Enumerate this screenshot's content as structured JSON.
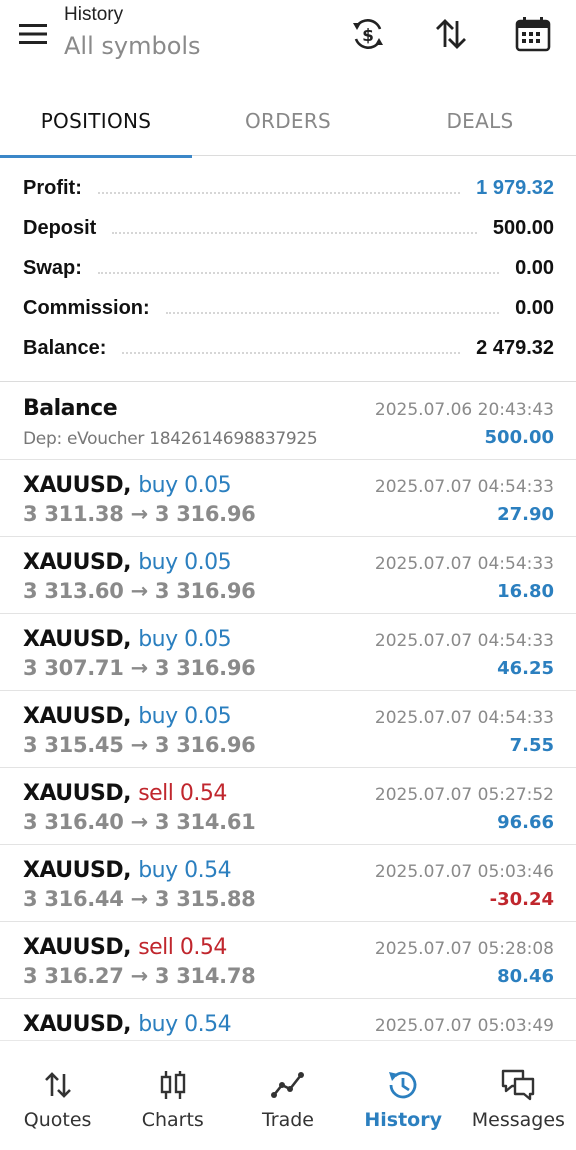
{
  "header": {
    "title": "History",
    "subtitle": "All symbols"
  },
  "tabs": [
    {
      "label": "POSITIONS",
      "active": true
    },
    {
      "label": "ORDERS",
      "active": false
    },
    {
      "label": "DEALS",
      "active": false
    }
  ],
  "summary": [
    {
      "label": "Profit:",
      "value": "1 979.32",
      "highlight": true
    },
    {
      "label": "Deposit",
      "value": "500.00",
      "highlight": false
    },
    {
      "label": "Swap:",
      "value": "0.00",
      "highlight": false
    },
    {
      "label": "Commission:",
      "value": "0.00",
      "highlight": false
    },
    {
      "label": "Balance:",
      "value": "2 479.32",
      "highlight": false
    }
  ],
  "balance_entry": {
    "title": "Balance",
    "comment": "Dep: eVoucher 1842614698837925",
    "time": "2025.07.06 20:43:43",
    "amount": "500.00"
  },
  "deals": [
    {
      "symbol": "XAUUSD,",
      "dir": "buy 0.05",
      "side": "buy",
      "prices": "3 311.38 → 3 316.96",
      "time": "2025.07.07 04:54:33",
      "profit": "27.90",
      "negative": false
    },
    {
      "symbol": "XAUUSD,",
      "dir": "buy 0.05",
      "side": "buy",
      "prices": "3 313.60 → 3 316.96",
      "time": "2025.07.07 04:54:33",
      "profit": "16.80",
      "negative": false
    },
    {
      "symbol": "XAUUSD,",
      "dir": "buy 0.05",
      "side": "buy",
      "prices": "3 307.71 → 3 316.96",
      "time": "2025.07.07 04:54:33",
      "profit": "46.25",
      "negative": false
    },
    {
      "symbol": "XAUUSD,",
      "dir": "buy 0.05",
      "side": "buy",
      "prices": "3 315.45 → 3 316.96",
      "time": "2025.07.07 04:54:33",
      "profit": "7.55",
      "negative": false
    },
    {
      "symbol": "XAUUSD,",
      "dir": "sell 0.54",
      "side": "sell",
      "prices": "3 316.40 → 3 314.61",
      "time": "2025.07.07 05:27:52",
      "profit": "96.66",
      "negative": false
    },
    {
      "symbol": "XAUUSD,",
      "dir": "buy 0.54",
      "side": "buy",
      "prices": "3 316.44 → 3 315.88",
      "time": "2025.07.07 05:03:46",
      "profit": "-30.24",
      "negative": true
    },
    {
      "symbol": "XAUUSD,",
      "dir": "sell 0.54",
      "side": "sell",
      "prices": "3 316.27 → 3 314.78",
      "time": "2025.07.07 05:28:08",
      "profit": "80.46",
      "negative": false
    },
    {
      "symbol": "XAUUSD,",
      "dir": "buy 0.54",
      "side": "buy",
      "prices": "",
      "time": "2025.07.07 05:03:49",
      "profit": "",
      "negative": false
    }
  ],
  "nav": [
    {
      "label": "Quotes",
      "icon": "quotes-icon",
      "active": false
    },
    {
      "label": "Charts",
      "icon": "charts-icon",
      "active": false
    },
    {
      "label": "Trade",
      "icon": "trade-icon",
      "active": false
    },
    {
      "label": "History",
      "icon": "history-icon",
      "active": true
    },
    {
      "label": "Messages",
      "icon": "messages-icon",
      "active": false
    }
  ],
  "colors": {
    "accent": "#2b7fbf",
    "negative": "#c0262d",
    "muted": "#8a8a8a"
  }
}
